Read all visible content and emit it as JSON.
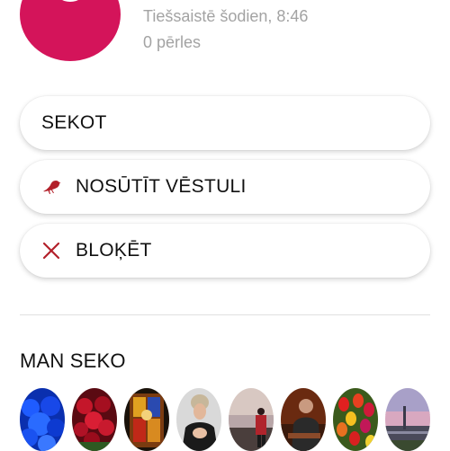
{
  "profile": {
    "online_status": "Tiešsaistē šodien, 8:46",
    "pearls": "0 pērles"
  },
  "actions": {
    "follow": "SEKOT",
    "send_message": "NOSŪTĪT VĒSTULI",
    "block": "BLOĶĒT"
  },
  "followers_section": {
    "title": "MAN SEKO"
  },
  "colors": {
    "avatar_brand": "#d4145a",
    "icon_red": "#b3202a",
    "meta_gray": "#a3a3a3"
  },
  "icons": {
    "message": "pigeon-icon",
    "block": "cross-icon"
  }
}
